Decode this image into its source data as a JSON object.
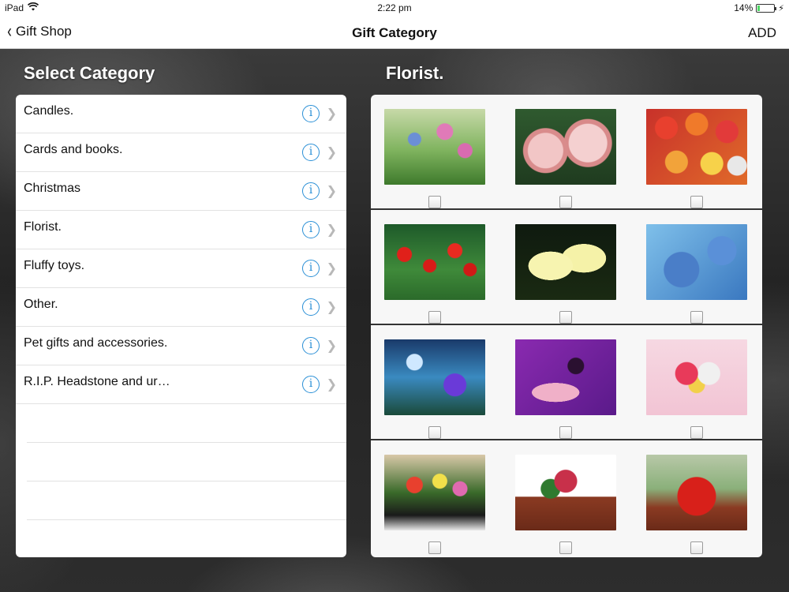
{
  "status": {
    "device": "iPad",
    "time": "2:22 pm",
    "battery_text": "14%",
    "battery_level": 0.14
  },
  "nav": {
    "back_label": "Gift Shop",
    "title": "Gift Category",
    "add_label": "ADD"
  },
  "left": {
    "title": "Select Category",
    "categories": [
      {
        "label": "Candles."
      },
      {
        "label": "Cards and books."
      },
      {
        "label": "Christmas"
      },
      {
        "label": "Florist."
      },
      {
        "label": "Fluffy toys."
      },
      {
        "label": "Other."
      },
      {
        "label": "Pet gifts and accessories."
      },
      {
        "label": "R.I.P. Headstone and ur…"
      }
    ]
  },
  "right": {
    "title": "Florist.",
    "rows": [
      [
        {
          "icon": "flower-meadow-photo"
        },
        {
          "icon": "pink-dahlia-photo"
        },
        {
          "icon": "colorful-roses-photo"
        }
      ],
      [
        {
          "icon": "red-poppies-photo"
        },
        {
          "icon": "yellow-lilies-photo"
        },
        {
          "icon": "blue-floral-art-photo"
        }
      ],
      [
        {
          "icon": "fantasy-flower-photo"
        },
        {
          "icon": "purple-butterfly-photo"
        },
        {
          "icon": "heart-bouquet-photo"
        }
      ],
      [
        {
          "icon": "casket-spray-photo"
        },
        {
          "icon": "casket-flowers-photo"
        },
        {
          "icon": "red-rose-casket-photo"
        }
      ]
    ]
  },
  "colors": {
    "accent": "#2a8fd6",
    "battery": "#4cd964"
  }
}
